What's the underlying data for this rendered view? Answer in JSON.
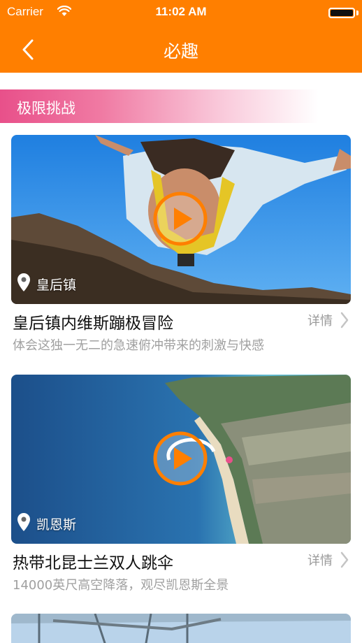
{
  "status_bar": {
    "carrier": "Carrier",
    "time": "11:02 AM"
  },
  "nav": {
    "title": "必趣"
  },
  "section": {
    "title": "极限挑战"
  },
  "cards": [
    {
      "location": "皇后镇",
      "title": "皇后镇内维斯蹦极冒险",
      "subtitle": "体会这独一无二的急速俯冲带来的刺激与快感",
      "detail": "详情"
    },
    {
      "location": "凯恩斯",
      "title": "热带北昆士兰双人跳伞",
      "subtitle": "14000英尺高空降落，观尽凯恩斯全景",
      "detail": "详情"
    }
  ],
  "colors": {
    "brand": "#ff7f00",
    "section_pink": "#e8508a"
  }
}
